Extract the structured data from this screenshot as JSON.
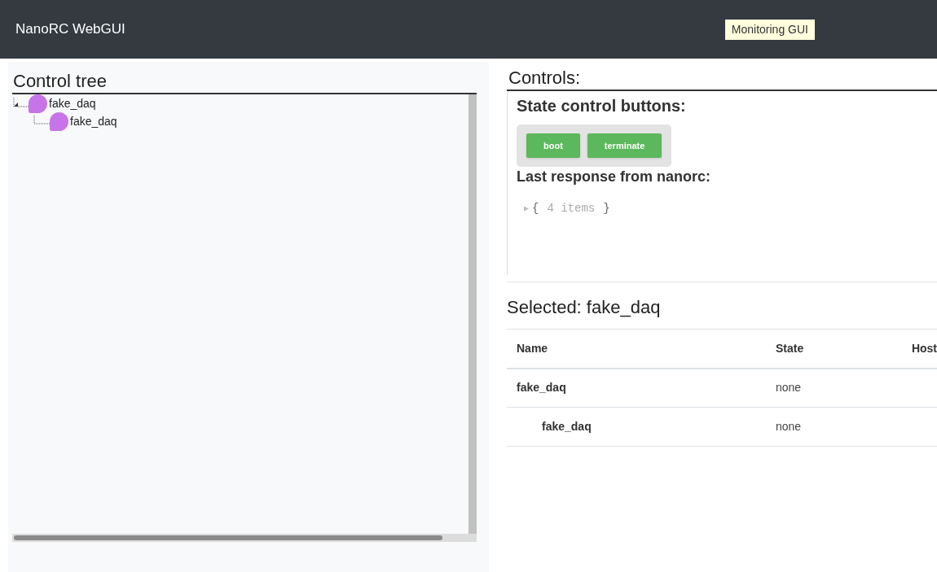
{
  "navbar": {
    "brand": "NanoRC WebGUI",
    "badge": "Monitoring GUI"
  },
  "control_tree": {
    "title": "Control tree",
    "nodes": [
      {
        "label": "fake_daq",
        "expanded": true,
        "children": [
          {
            "label": "fake_daq"
          }
        ]
      }
    ]
  },
  "controls": {
    "title": "Controls:",
    "state_title": "State control buttons:",
    "buttons": [
      "boot",
      "terminate"
    ],
    "response_title": "Last response from nanorc:",
    "response": {
      "toggle": "▶",
      "open": "{",
      "summary": "4 items",
      "close": "}"
    }
  },
  "selected": {
    "title": "Selected: fake_daq",
    "columns": [
      "Name",
      "State",
      "Host"
    ],
    "rows": [
      {
        "name": "fake_daq",
        "state": "none",
        "children": [
          {
            "name": "fake_daq",
            "state": "none"
          }
        ]
      }
    ]
  }
}
